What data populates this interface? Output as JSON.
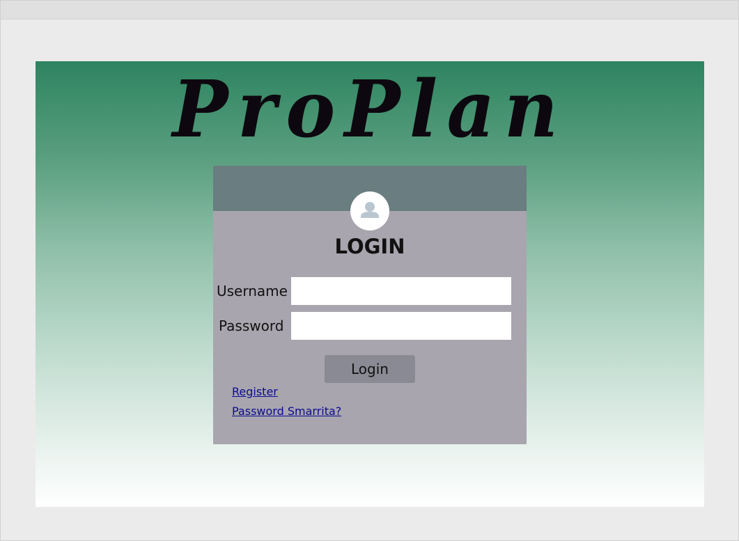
{
  "app": {
    "title": "ProPlan"
  },
  "login": {
    "heading": "LOGIN",
    "username_label": "Username",
    "username_value": "",
    "password_label": "Password",
    "password_value": "",
    "submit_label": "Login",
    "register_link": "Register",
    "forgot_link": "Password Smarrita?"
  },
  "icons": {
    "avatar": "user-icon"
  },
  "colors": {
    "gradient_top": "#2e8460",
    "gradient_bottom": "#ffffff",
    "card_header": "#6a7d80",
    "card_body": "#a8a5ae",
    "button": "#898a93",
    "link": "#0b0b8f"
  }
}
